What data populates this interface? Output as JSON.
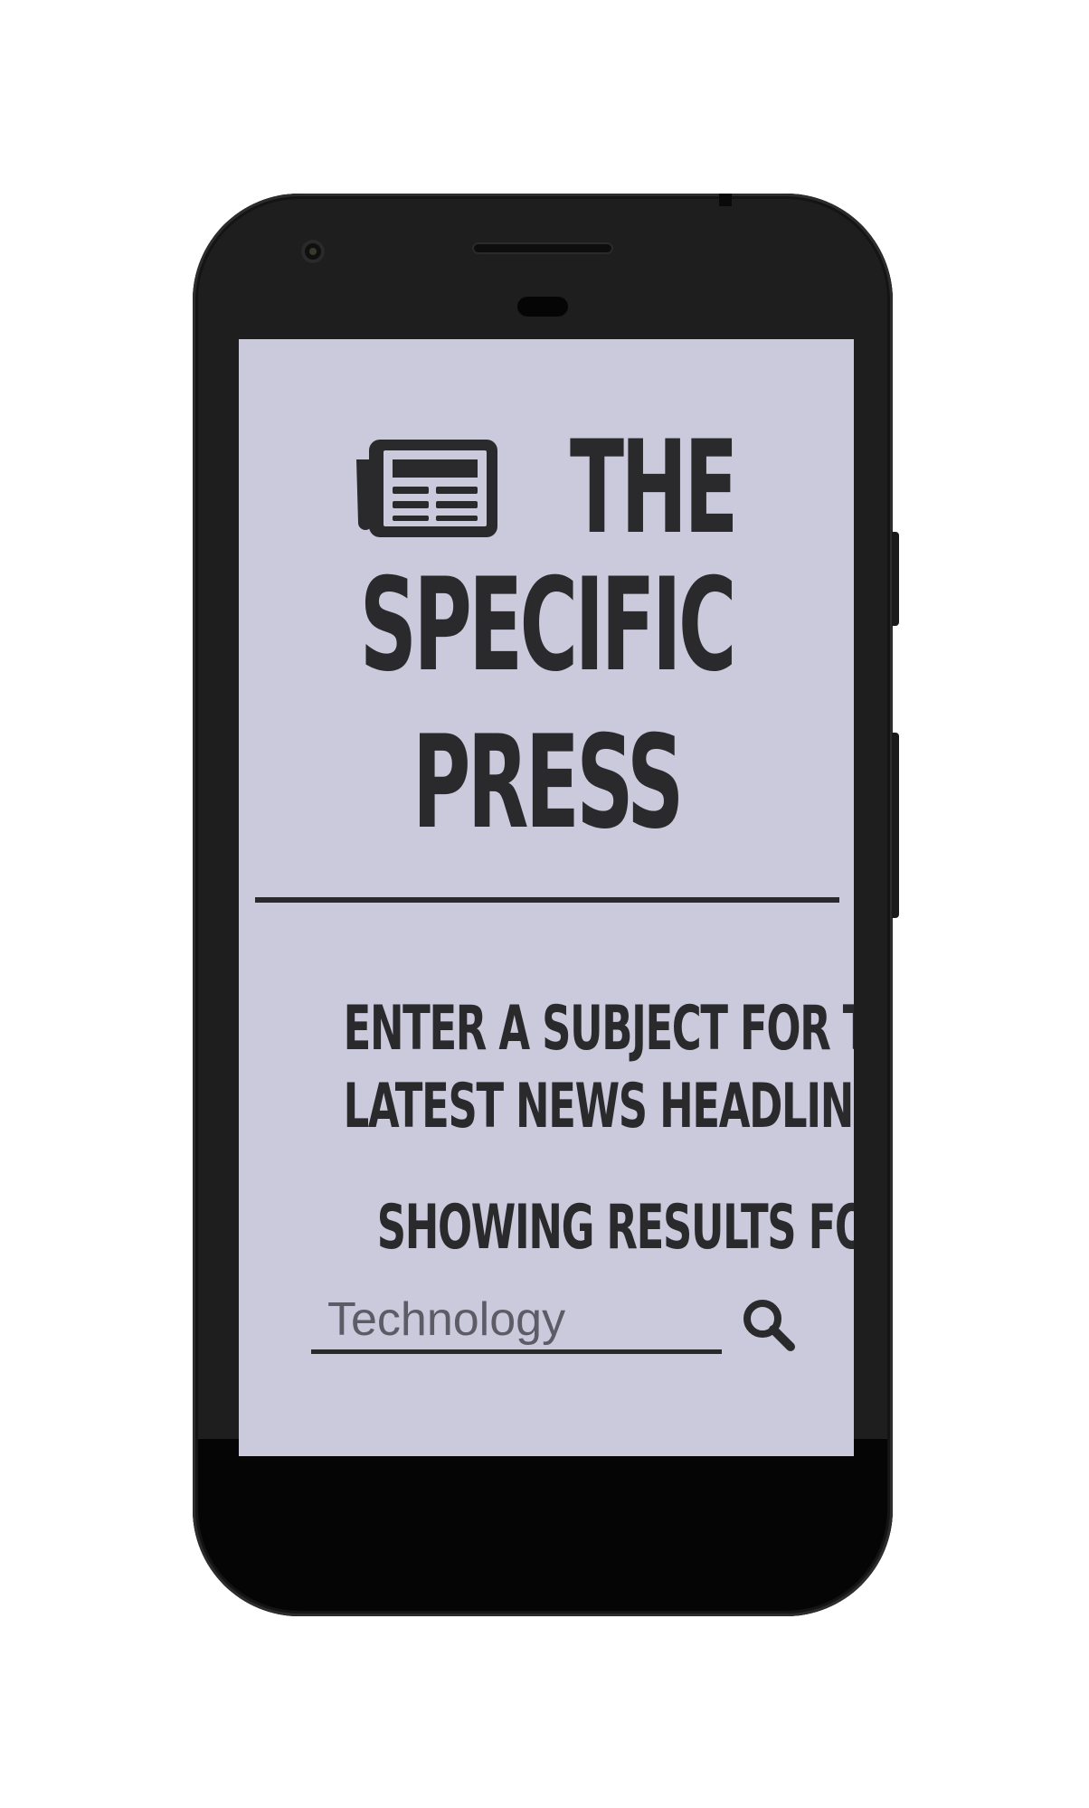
{
  "app": {
    "title_words": [
      "THE",
      "SPECIFIC",
      "PRESS"
    ],
    "logo_icon": "newspaper-icon"
  },
  "main": {
    "prompt_lines": [
      "ENTER A SUBJECT FOR THE",
      "LATEST NEWS HEADLINES"
    ],
    "results_label": "SHOWING RESULTS FOR:"
  },
  "search": {
    "value": "Technology",
    "icon": "search-icon"
  },
  "colors": {
    "screen_background": "#cbc9dc",
    "text": "#2a2a2c",
    "input_text": "#5d5b66"
  }
}
